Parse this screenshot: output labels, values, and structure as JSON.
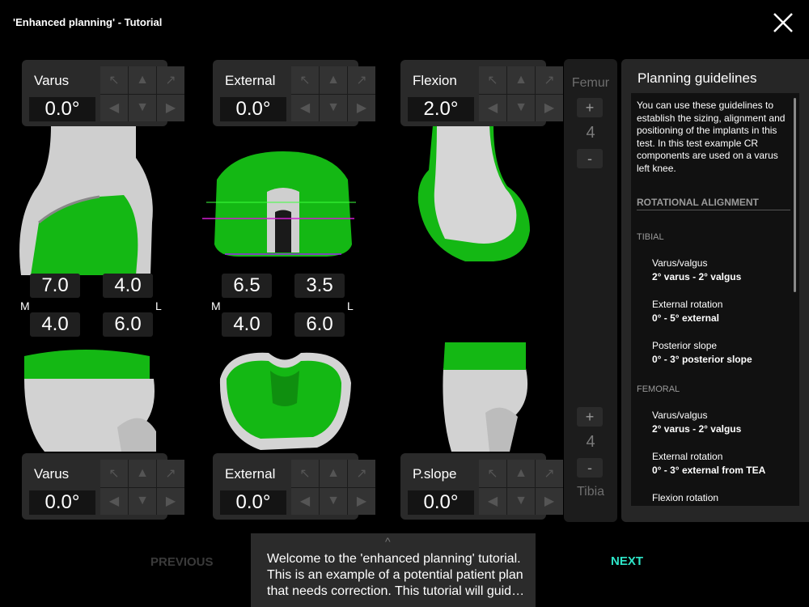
{
  "window": {
    "title": "'Enhanced planning' - Tutorial",
    "close_icon": "close-icon"
  },
  "colors": {
    "implant": "#14b814",
    "accent": "#2ee5c8",
    "panel": "#2a2a2a",
    "background": "#000000"
  },
  "controls": {
    "femur_coronal": {
      "label": "Varus",
      "value": "0.0°"
    },
    "femur_axial": {
      "label": "External",
      "value": "0.0°"
    },
    "femur_sagittal": {
      "label": "Flexion",
      "value": "2.0°"
    },
    "tibia_coronal": {
      "label": "Varus",
      "value": "0.0°"
    },
    "tibia_axial": {
      "label": "External",
      "value": "0.0°"
    },
    "tibia_sagittal": {
      "label": "P.slope",
      "value": "0.0°"
    }
  },
  "arrow_icons": [
    "arrow-up-left-icon",
    "arrow-up-icon",
    "arrow-up-right-icon",
    "arrow-left-icon",
    "arrow-down-icon",
    "arrow-right-icon"
  ],
  "measurements": {
    "coronal": {
      "medial_label": "M",
      "lateral_label": "L",
      "top_left": "7.0",
      "top_right": "4.0",
      "bottom_left": "4.0",
      "bottom_right": "6.0"
    },
    "axial": {
      "medial_label": "M",
      "lateral_label": "L",
      "top_left": "6.5",
      "top_right": "3.5",
      "bottom_left": "4.0",
      "bottom_right": "6.0"
    }
  },
  "size": {
    "femur": {
      "label": "Femur",
      "plus": "+",
      "value": "4",
      "minus": "-"
    },
    "tibia": {
      "label": "Tibia",
      "plus": "+",
      "value": "4",
      "minus": "-"
    }
  },
  "guidelines": {
    "title": "Planning guidelines",
    "intro": "You can use these guidelines to establish the sizing, alignment and positioning of the implants in this test. In this test example CR components are used on a varus left knee.",
    "section": "ROTATIONAL ALIGNMENT",
    "tibial_label": "TIBIAL",
    "femoral_label": "FEMORAL",
    "tibial": [
      {
        "name": "Varus/valgus",
        "value": "2° varus - 2° valgus"
      },
      {
        "name": "External rotation",
        "value": "0° - 5° external"
      },
      {
        "name": "Posterior slope",
        "value": "0° - 3° posterior slope"
      }
    ],
    "femoral": [
      {
        "name": "Varus/valgus",
        "value": "2° varus - 2° valgus"
      },
      {
        "name": "External rotation",
        "value": "0° - 3° external from TEA"
      },
      {
        "name": "Flexion rotation",
        "value": ""
      }
    ]
  },
  "navigation": {
    "previous": "PREVIOUS",
    "next": "NEXT"
  },
  "tutorial": {
    "message": "Welcome to the 'enhanced planning' tutorial. This is an example of a potential patient plan that needs correction. This tutorial will guid…",
    "chevron_icon": "chevron-up-icon"
  }
}
